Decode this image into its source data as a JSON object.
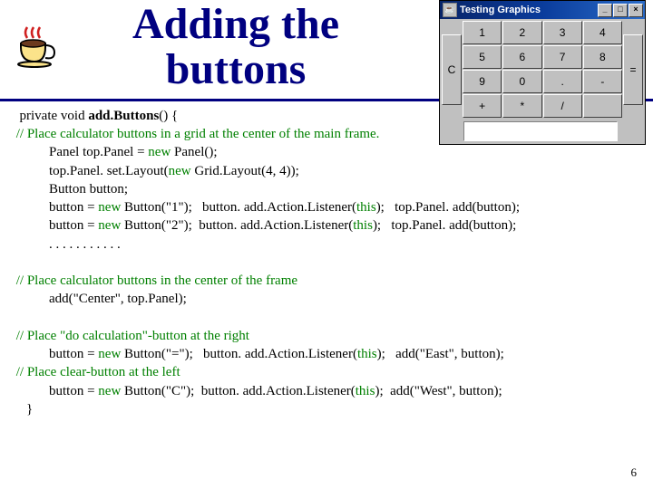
{
  "slide": {
    "title_line1": "Adding the",
    "title_line2": "buttons",
    "page_number": "6"
  },
  "calc": {
    "title": "Testing Graphics",
    "win_min": "_",
    "win_max": "□",
    "win_close": "×",
    "clear": "C",
    "equals": "=",
    "buttons": [
      "1",
      "2",
      "3",
      "4",
      "5",
      "6",
      "7",
      "8",
      "9",
      "0",
      ".",
      "-",
      "+",
      "*",
      "/"
    ]
  },
  "code": {
    "l1a": "  private void ",
    "l1b": "add.Buttons",
    "l1c": "() {",
    "l2": " // Place calculator buttons in a grid at the center of the main frame.",
    "l3a": "Panel top.Panel = ",
    "l3b": "new",
    "l3c": " Panel();",
    "l4a": "top.Panel. set.Layout(",
    "l4b": "new",
    "l4c": " Grid.Layout(4, 4));",
    "l5": "Button button;",
    "l6a": "button = ",
    "l6b": "new",
    "l6c": " Button(\"1\");   button. add.Action.Listener(",
    "l6d": "this",
    "l6e": ");   top.Panel. add(button);",
    "l7a": "button = ",
    "l7b": "new",
    "l7c": " Button(\"2\");  button. add.Action.Listener(",
    "l7d": "this",
    "l7e": ");   top.Panel. add(button);",
    "l8": ". . . . . . . . . . .",
    "l9": " // Place calculator buttons in the center of the frame",
    "l10": "add(\"Center\", top.Panel);",
    "l11": " // Place \"do calculation\"-button at the right",
    "l12a": "button = ",
    "l12b": "new",
    "l12c": " Button(\"=\");   button. add.Action.Listener(",
    "l12d": "this",
    "l12e": ");   add(\"East\", button);",
    "l13": " // Place clear-button at the left",
    "l14a": "button = ",
    "l14b": "new",
    "l14c": " Button(\"C\");  button. add.Action.Listener(",
    "l14d": "this",
    "l14e": ");  add(\"West\", button);",
    "l15": "    }"
  }
}
